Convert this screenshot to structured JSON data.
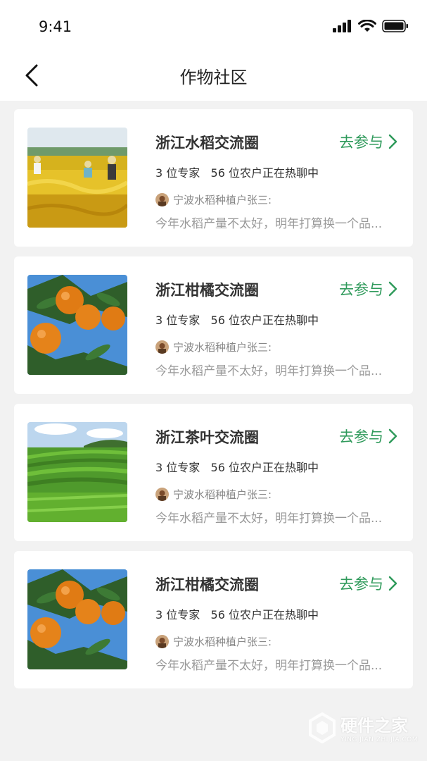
{
  "status_bar": {
    "time": "9:41"
  },
  "header": {
    "title": "作物社区"
  },
  "colors": {
    "accent": "#2f9a5b",
    "background": "#f2f2f2",
    "card": "#ffffff"
  },
  "cards": [
    {
      "title": "浙江水稻交流圈",
      "join": "去参与",
      "stats": "3 位专家   56 位农户正在热聊中",
      "author": "宁波水稻种植户张三:",
      "message": "今年水稻产量不太好，明年打算换一个品...",
      "image": "rice-field"
    },
    {
      "title": "浙江柑橘交流圈",
      "join": "去参与",
      "stats": "3 位专家   56 位农户正在热聊中",
      "author": "宁波水稻种植户张三:",
      "message": "今年水稻产量不太好，明年打算换一个品...",
      "image": "tangerines"
    },
    {
      "title": "浙江茶叶交流圈",
      "join": "去参与",
      "stats": "3 位专家   56 位农户正在热聊中",
      "author": "宁波水稻种植户张三:",
      "message": "今年水稻产量不太好，明年打算换一个品...",
      "image": "tea-plantation"
    },
    {
      "title": "浙江柑橘交流圈",
      "join": "去参与",
      "stats": "3 位专家   56 位农户正在热聊中",
      "author": "宁波水稻种植户张三:",
      "message": "今年水稻产量不太好，明年打算换一个品...",
      "image": "tangerines"
    }
  ],
  "watermark": {
    "name": "硬件之家",
    "sub": "YING JIAN ZHI JIA.COM"
  }
}
